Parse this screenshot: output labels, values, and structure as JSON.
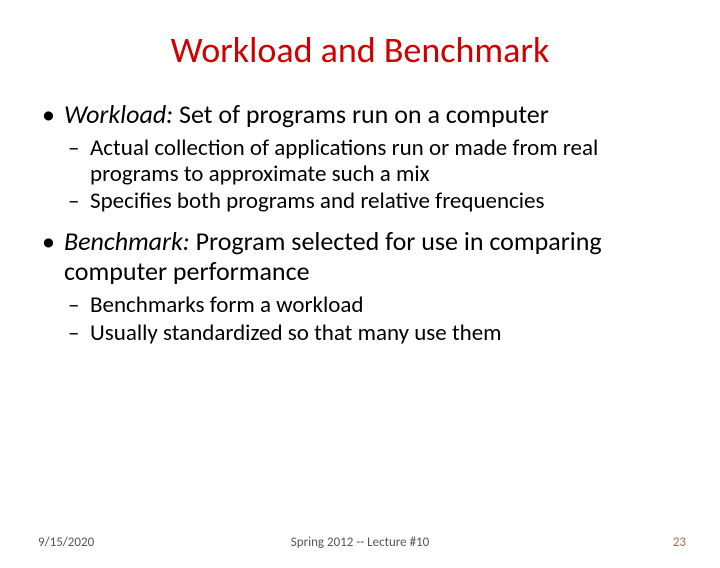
{
  "title": "Workload and Benchmark",
  "bullets": {
    "b1_label": "Workload:",
    "b1_rest": " Set of programs run on a computer",
    "b1_sub1": "Actual collection of applications run or made from real programs to approximate such a mix",
    "b1_sub2": "Specifies both programs and relative frequencies",
    "b2_label": "Benchmark:",
    "b2_rest": " Program selected for use in comparing computer performance",
    "b2_sub1": "Benchmarks form a workload",
    "b2_sub2": "Usually standardized so that many use them"
  },
  "footer": {
    "date": "9/15/2020",
    "center": "Spring 2012 -- Lecture #10",
    "page": "23"
  }
}
